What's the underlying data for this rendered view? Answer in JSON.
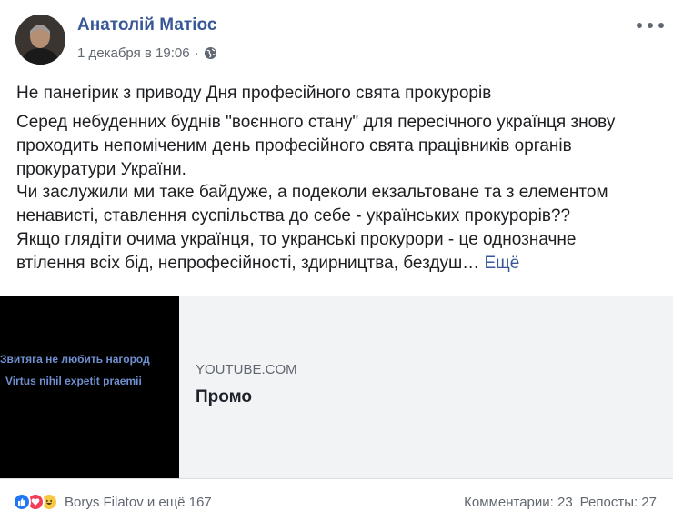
{
  "post": {
    "author": "Анатолій Матіос",
    "date": "1 декабря в 19:06",
    "separator": "·",
    "privacy_icon": "globe-icon",
    "more_icon": "more-options-icon",
    "title": "Не панегірик з приводу Дня професійного свята прокурорів",
    "body_lines": [
      "Серед небуденних буднів \"воєнного стану\" для пересічного українця знову",
      "проходить непоміченим день професійного свята працівників органів",
      "прокуратури України.",
      "Чи заслужили ми таке байдуже, а подеколи екзальтоване та з елементом",
      "ненависті, ставлення суспільства до себе - українських прокурорів??",
      "Якщо глядіти очима українця, то укранські прокурори - це однозначне"
    ],
    "last_line": "втілення всіх бід, непрофесійності, здирництва, бездуш…",
    "see_more": "Ещё"
  },
  "link_preview": {
    "thumb_line_1": "Звитяга не любить нагород",
    "thumb_line_2": "Virtus nihil expetit praemii",
    "source": "YOUTUBE.COM",
    "title": "Промо"
  },
  "footer": {
    "reactions": [
      "like",
      "love",
      "haha"
    ],
    "reaction_names": "Borys Filatov и ещё 167",
    "comments": "Комментарии: 23",
    "shares": "Репосты: 27"
  },
  "colors": {
    "link_blue": "#385898",
    "meta_gray": "#606770",
    "like_blue": "#2078f4",
    "love_red": "#f33e58",
    "haha_yellow": "#f7c842"
  }
}
